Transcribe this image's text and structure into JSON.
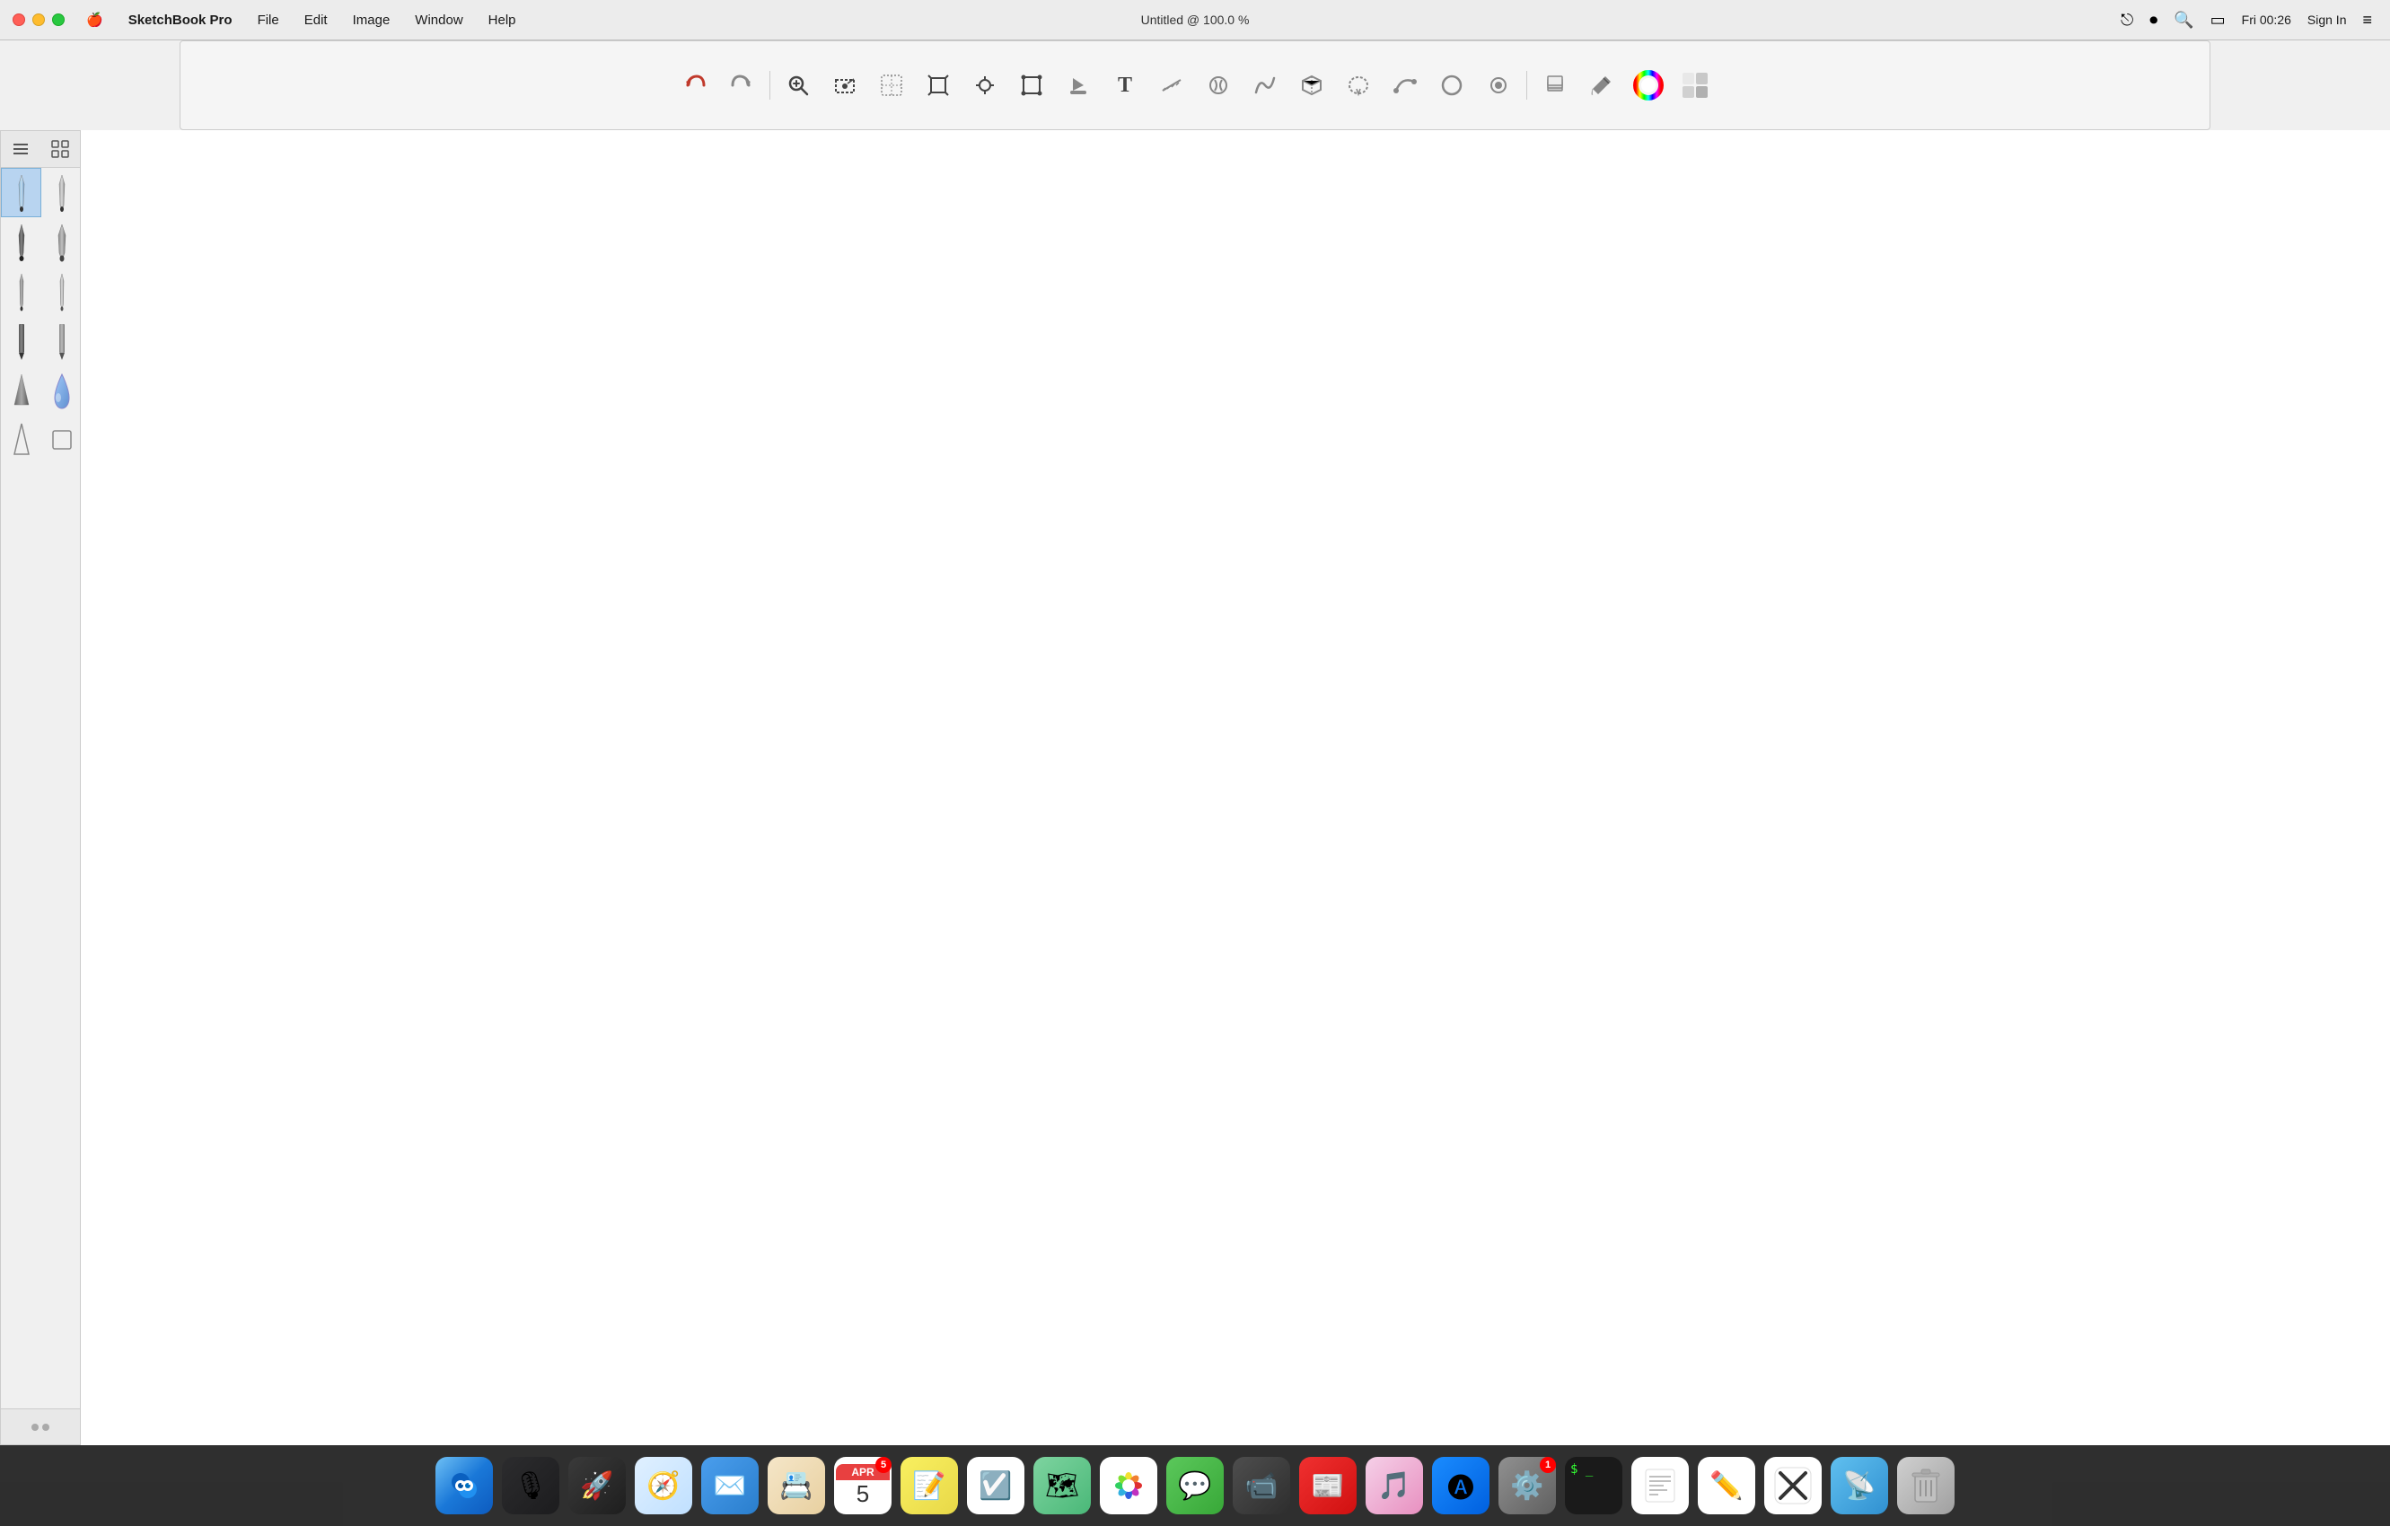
{
  "menubar": {
    "apple_icon": "🍎",
    "app_name": "SketchBook Pro",
    "menus": [
      "File",
      "Edit",
      "Image",
      "Window",
      "Help"
    ],
    "title": "Untitled @ 100.0 %",
    "time": "Fri 00:26",
    "sign_in": "Sign In"
  },
  "toolbar": {
    "tools": [
      {
        "name": "undo",
        "icon": "↩",
        "label": "Undo"
      },
      {
        "name": "redo",
        "icon": "↪",
        "label": "Redo"
      },
      {
        "name": "zoom",
        "icon": "🔍",
        "label": "Zoom"
      },
      {
        "name": "select-rect",
        "icon": "⊹",
        "label": "Rectangular Select"
      },
      {
        "name": "select-magic",
        "icon": "⊞",
        "label": "Magic Select"
      },
      {
        "name": "crop",
        "icon": "⊡",
        "label": "Crop"
      },
      {
        "name": "transform",
        "icon": "⊕",
        "label": "Transform"
      },
      {
        "name": "warp",
        "icon": "⬡",
        "label": "Warp"
      },
      {
        "name": "fill",
        "icon": "🪣",
        "label": "Fill"
      },
      {
        "name": "text",
        "icon": "T",
        "label": "Text"
      },
      {
        "name": "ruler",
        "icon": "📐",
        "label": "Ruler"
      },
      {
        "name": "symmetry",
        "icon": "◈",
        "label": "Symmetry"
      },
      {
        "name": "curve",
        "icon": "〜",
        "label": "Curve"
      },
      {
        "name": "3d",
        "icon": "⬡",
        "label": "3D"
      },
      {
        "name": "lasso",
        "icon": "⌖",
        "label": "Lasso"
      },
      {
        "name": "stroke",
        "icon": "⌒",
        "label": "Stroke"
      },
      {
        "name": "circle",
        "icon": "○",
        "label": "Circle"
      },
      {
        "name": "stamp",
        "icon": "◉",
        "label": "Stamp"
      },
      {
        "name": "layers",
        "icon": "⧉",
        "label": "Layers"
      },
      {
        "name": "brushes",
        "icon": "✒",
        "label": "Brushes"
      },
      {
        "name": "color-wheel",
        "icon": "🎨",
        "label": "Color Wheel"
      },
      {
        "name": "palette",
        "icon": "⊞",
        "label": "Palette"
      }
    ]
  },
  "brush_panel": {
    "tab1_icon": "≡",
    "tab2_icon": "⊞",
    "brushes": [
      {
        "id": 1,
        "type": "pen",
        "selected": true
      },
      {
        "id": 2,
        "type": "pen2"
      },
      {
        "id": 3,
        "type": "marker"
      },
      {
        "id": 4,
        "type": "marker2"
      },
      {
        "id": 5,
        "type": "fine1"
      },
      {
        "id": 6,
        "type": "fine2"
      },
      {
        "id": 7,
        "type": "pencil1"
      },
      {
        "id": 8,
        "type": "pencil2"
      },
      {
        "id": 9,
        "type": "triangle"
      },
      {
        "id": 10,
        "type": "drop"
      },
      {
        "id": 11,
        "type": "flat1"
      },
      {
        "id": 12,
        "type": "flat2"
      }
    ]
  },
  "dock": {
    "items": [
      {
        "name": "Finder",
        "icon": "🗂",
        "class": "dock-finder"
      },
      {
        "name": "Siri",
        "icon": "🎙",
        "class": "dock-siri"
      },
      {
        "name": "Launchpad",
        "icon": "🚀",
        "class": "dock-launchpad"
      },
      {
        "name": "Safari",
        "icon": "🧭",
        "class": "dock-safari"
      },
      {
        "name": "Mail",
        "icon": "✉",
        "class": "dock-mail"
      },
      {
        "name": "Contacts",
        "icon": "📇",
        "class": "dock-contacts"
      },
      {
        "name": "Calendar",
        "icon": "📅",
        "class": "dock-calendar",
        "badge": "5"
      },
      {
        "name": "Notes",
        "icon": "📝",
        "class": "dock-notes"
      },
      {
        "name": "Reminders",
        "icon": "☑",
        "class": "dock-reminders"
      },
      {
        "name": "Maps",
        "icon": "🗺",
        "class": "dock-maps"
      },
      {
        "name": "Photos",
        "icon": "🌸",
        "class": "dock-photos"
      },
      {
        "name": "Messages",
        "icon": "💬",
        "class": "dock-messages"
      },
      {
        "name": "FaceTime",
        "icon": "📹",
        "class": "dock-facetime"
      },
      {
        "name": "News",
        "icon": "📰",
        "class": "dock-news"
      },
      {
        "name": "Music",
        "icon": "🎵",
        "class": "dock-music"
      },
      {
        "name": "App Store",
        "icon": "🅐",
        "class": "dock-appstore"
      },
      {
        "name": "System Preferences",
        "icon": "⚙",
        "class": "dock-sysprefs",
        "badge": "1"
      },
      {
        "name": "Terminal",
        "icon": "⌨",
        "class": "dock-terminal"
      },
      {
        "name": "TextEdit",
        "icon": "📄",
        "class": "dock-textedit"
      },
      {
        "name": "SketchBook X",
        "icon": "✕",
        "class": "dock-sketchbook-x"
      },
      {
        "name": "Pencil",
        "icon": "✏",
        "class": "dock-pencil"
      },
      {
        "name": "AirDrop",
        "icon": "📡",
        "class": "dock-airdrop"
      },
      {
        "name": "Trash",
        "icon": "🗑",
        "class": "dock-trash"
      }
    ]
  }
}
